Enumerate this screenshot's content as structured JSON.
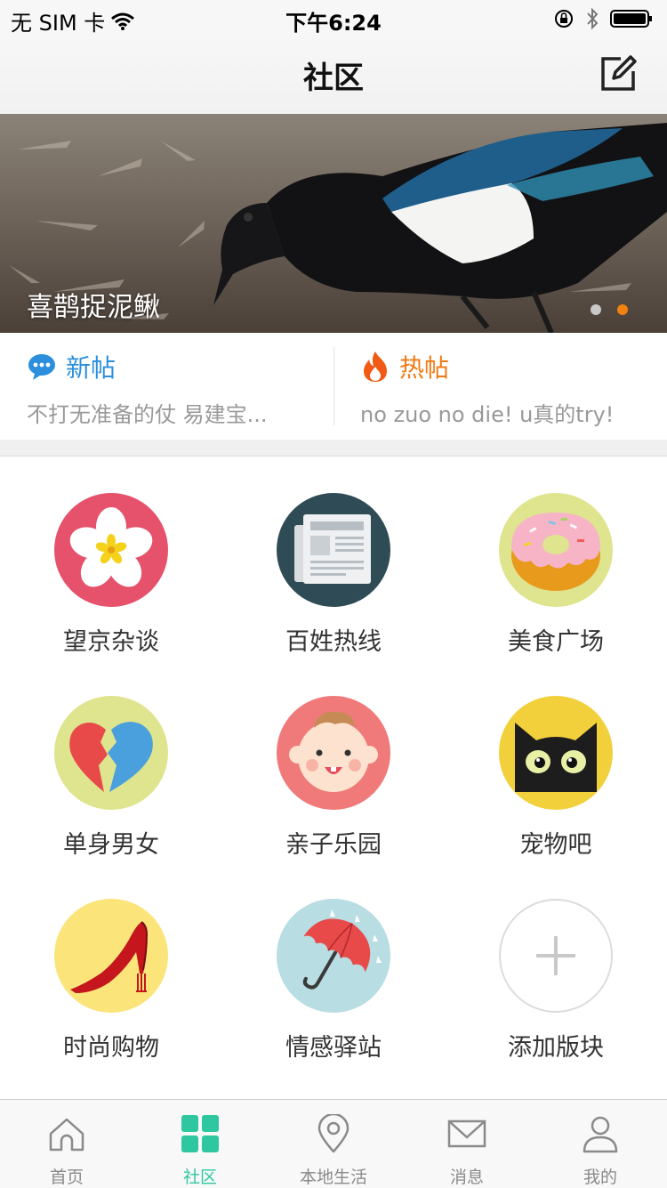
{
  "status_bar": {
    "carrier": "无 SIM 卡",
    "time": "下午6:24"
  },
  "nav": {
    "title": "社区"
  },
  "banner": {
    "caption": "喜鹊捉泥鳅",
    "page_count": 2,
    "active_index": 1,
    "active_dot_color": "#f0820f"
  },
  "posts": {
    "new": {
      "title": "新帖",
      "preview": "不打无准备的仗 易建宝...",
      "color": "#2b8fde",
      "icon": "chat-bubble-icon"
    },
    "hot": {
      "title": "热帖",
      "preview": "no zuo no die! u真的try!",
      "color": "#f07a14",
      "icon": "flame-icon"
    }
  },
  "boards": [
    {
      "label": "望京杂谈",
      "icon": "flower-icon"
    },
    {
      "label": "百姓热线",
      "icon": "newspaper-icon"
    },
    {
      "label": "美食广场",
      "icon": "donut-icon"
    },
    {
      "label": "单身男女",
      "icon": "split-heart-icon"
    },
    {
      "label": "亲子乐园",
      "icon": "baby-face-icon"
    },
    {
      "label": "宠物吧",
      "icon": "black-cat-icon"
    },
    {
      "label": "时尚购物",
      "icon": "high-heel-icon"
    },
    {
      "label": "情感驿站",
      "icon": "umbrella-icon"
    },
    {
      "label": "添加版块",
      "icon": "plus-icon"
    }
  ],
  "tabs": [
    {
      "label": "首页",
      "icon": "home-icon"
    },
    {
      "label": "社区",
      "icon": "grid-icon",
      "active": true
    },
    {
      "label": "本地生活",
      "icon": "location-pin-icon"
    },
    {
      "label": "消息",
      "icon": "envelope-icon"
    },
    {
      "label": "我的",
      "icon": "person-icon"
    }
  ],
  "colors": {
    "accent": "#2ec7a0",
    "inactive_tab": "#8a8a8a"
  }
}
